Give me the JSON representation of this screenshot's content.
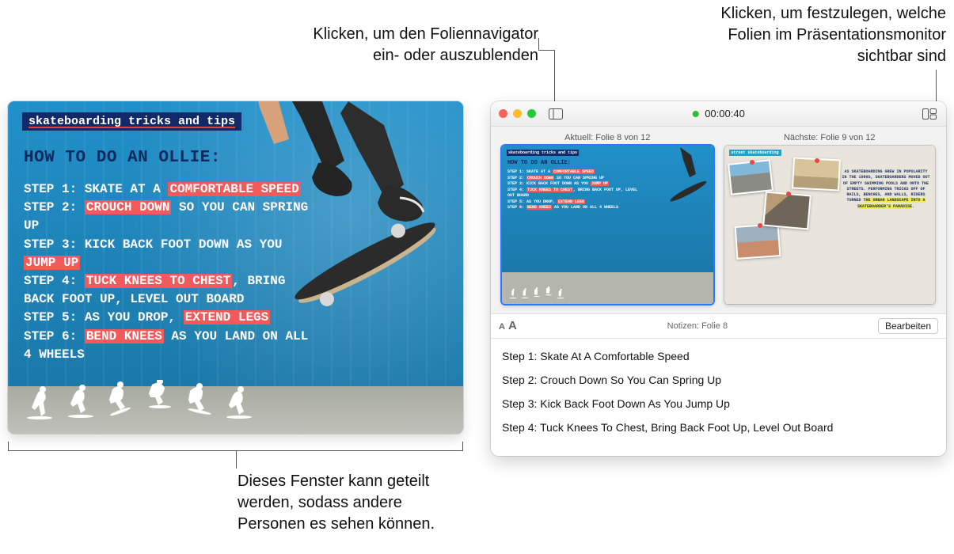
{
  "callouts": {
    "navigator": "Klicken, um den Foliennavigator\nein- oder auszublenden",
    "layout": "Klicken, um festzulegen, welche\nFolien im Präsentationsmonitor\nsichtbar sind",
    "share": "Dieses Fenster kann geteilt\nwerden, sodass andere\nPersonen es sehen können."
  },
  "slide": {
    "tag_text": "skateboarding tricks and tips",
    "title": "HOW TO DO AN OLLIE:",
    "steps": {
      "s1_prefix": "STEP 1: ",
      "s1_a": "SKATE AT A ",
      "s1_hl": "COMFORTABLE SPEED",
      "s2_prefix": "STEP 2: ",
      "s2_hl": "CROUCH DOWN",
      "s2_b": " SO YOU CAN SPRING UP",
      "s3_prefix": "STEP 3: ",
      "s3_a": "KICK BACK FOOT DOWN AS YOU ",
      "s3_hl": "JUMP UP",
      "s4_prefix": "STEP 4: ",
      "s4_hl": "TUCK KNEES TO CHEST",
      "s4_b": ", BRING BACK FOOT UP, LEVEL OUT BOARD",
      "s5_prefix": "STEP 5: ",
      "s5_a": "AS YOU DROP, ",
      "s5_hl": "EXTEND LEGS",
      "s6_prefix": "STEP 6: ",
      "s6_hl": "BEND KNEES",
      "s6_b": " AS YOU LAND ON ALL 4 WHEELS"
    }
  },
  "presenter": {
    "timer": "00:00:40",
    "current_label": "Aktuell: Folie 8 von 12",
    "next_label": "Nächste: Folie 9 von 12",
    "next_slide": {
      "tag": "street skateboarding",
      "text_a": "AS SKATEBOARDING GREW IN POPULARITY IN THE 1980S, SKATEBOARDERS MOVED OUT OF EMPTY SWIMMING POOLS AND ONTO THE STREETS. PERFORMING TRICKS OFF OF RAILS, BENCHES, AND WALLS, RIDERS TURNED ",
      "text_hl": "THE URBAN LANDSCAPE INTO A SKATEBOARDER'S PARADISE",
      "text_b": "."
    },
    "notes_label": "Notizen: Folie 8",
    "edit_label": "Bearbeiten",
    "notes": {
      "n1": "Step 1: Skate At A Comfortable Speed",
      "n2": "Step 2: Crouch Down So You Can Spring Up",
      "n3": "Step 3: Kick Back Foot Down As You Jump Up",
      "n4": "Step 4: Tuck Knees To Chest, Bring Back Foot Up, Level Out Board"
    }
  }
}
